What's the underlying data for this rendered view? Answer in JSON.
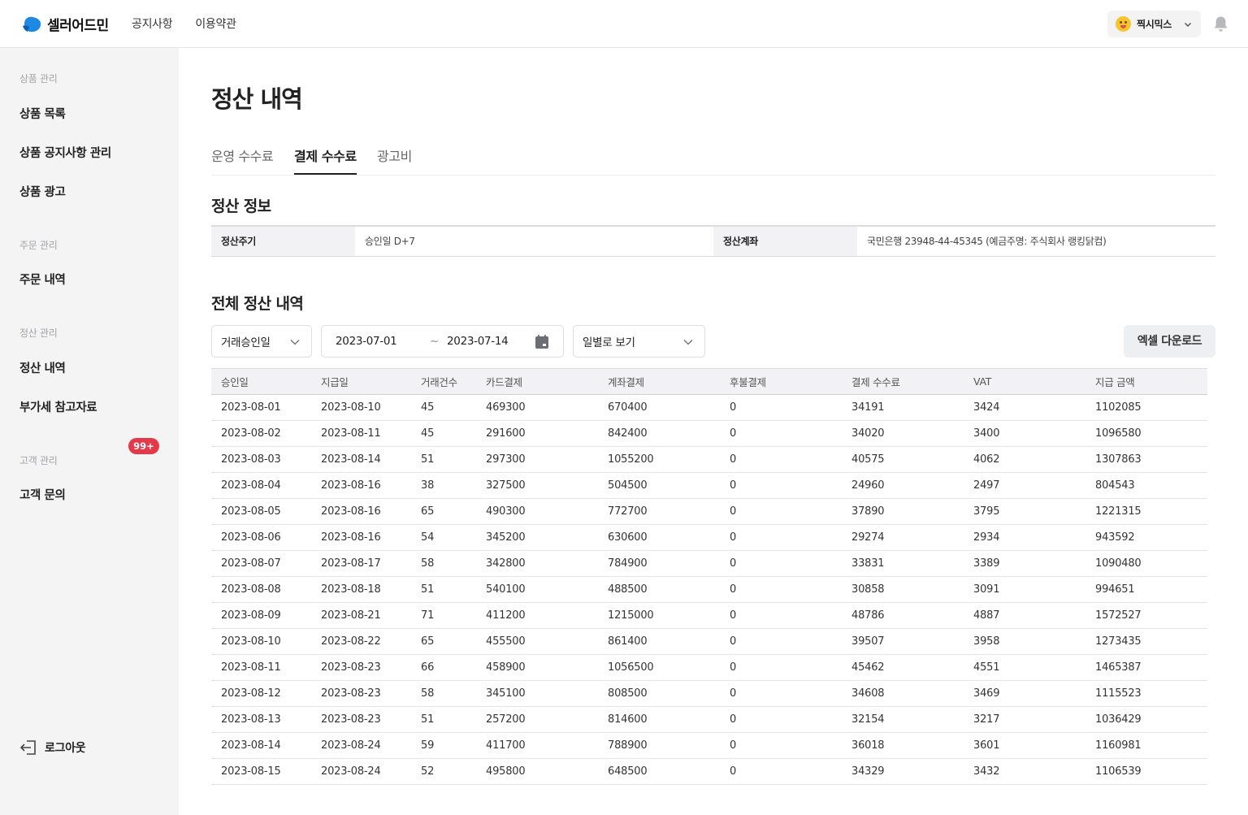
{
  "header": {
    "logo_text": "셀러어드민",
    "nav": [
      "공지사항",
      "이용약관"
    ],
    "user_name": "찍시믹스"
  },
  "sidebar": {
    "groups": [
      {
        "label": "상품 관리",
        "items": [
          "상품 목록",
          "상품 공지사항 관리",
          "상품 광고"
        ]
      },
      {
        "label": "주문 관리",
        "items": [
          "주문 내역"
        ]
      },
      {
        "label": "정산 관리",
        "items": [
          "정산 내역",
          "부가세 참고자료"
        ]
      },
      {
        "label": "고객 관리",
        "items": [
          "고객 문의"
        ]
      }
    ],
    "inquiry_badge": "99+",
    "logout_label": "로그아웃"
  },
  "main": {
    "title": "정산 내역",
    "tabs": [
      "운영 수수료",
      "결제 수수료",
      "광고비"
    ],
    "active_tab": "결제 수수료",
    "info_title": "정산 정보",
    "info": {
      "cycle_label": "정산주기",
      "cycle_value": "승인일 D+7",
      "account_label": "정산계좌",
      "account_value": "국민은행 23948-44-45345 (예금주명: 주식회사 랭킹닭컴)"
    },
    "list_title": "전체 정산 내역",
    "filters": {
      "date_type": "거래승인일",
      "date_from": "2023-07-01",
      "date_sep": "~",
      "date_to": "2023-07-14",
      "view_mode": "일별로 보기"
    },
    "excel_button": "엑셀 다운로드",
    "table": {
      "columns": [
        "승인일",
        "지급일",
        "거래건수",
        "카드결제",
        "계좌결제",
        "후불결제",
        "결제 수수료",
        "VAT",
        "지급 금액"
      ],
      "rows": [
        [
          "2023-08-01",
          "2023-08-10",
          "45",
          "469300",
          "670400",
          "0",
          "34191",
          "3424",
          "1102085"
        ],
        [
          "2023-08-02",
          "2023-08-11",
          "45",
          "291600",
          "842400",
          "0",
          "34020",
          "3400",
          "1096580"
        ],
        [
          "2023-08-03",
          "2023-08-14",
          "51",
          "297300",
          "1055200",
          "0",
          "40575",
          "4062",
          "1307863"
        ],
        [
          "2023-08-04",
          "2023-08-16",
          "38",
          "327500",
          "504500",
          "0",
          "24960",
          "2497",
          "804543"
        ],
        [
          "2023-08-05",
          "2023-08-16",
          "65",
          "490300",
          "772700",
          "0",
          "37890",
          "3795",
          "1221315"
        ],
        [
          "2023-08-06",
          "2023-08-16",
          "54",
          "345200",
          "630600",
          "0",
          "29274",
          "2934",
          "943592"
        ],
        [
          "2023-08-07",
          "2023-08-17",
          "58",
          "342800",
          "784900",
          "0",
          "33831",
          "3389",
          "1090480"
        ],
        [
          "2023-08-08",
          "2023-08-18",
          "51",
          "540100",
          "488500",
          "0",
          "30858",
          "3091",
          "994651"
        ],
        [
          "2023-08-09",
          "2023-08-21",
          "71",
          "411200",
          "1215000",
          "0",
          "48786",
          "4887",
          "1572527"
        ],
        [
          "2023-08-10",
          "2023-08-22",
          "65",
          "455500",
          "861400",
          "0",
          "39507",
          "3958",
          "1273435"
        ],
        [
          "2023-08-11",
          "2023-08-23",
          "66",
          "458900",
          "1056500",
          "0",
          "45462",
          "4551",
          "1465387"
        ],
        [
          "2023-08-12",
          "2023-08-23",
          "58",
          "345100",
          "808500",
          "0",
          "34608",
          "3469",
          "1115523"
        ],
        [
          "2023-08-13",
          "2023-08-23",
          "51",
          "257200",
          "814600",
          "0",
          "32154",
          "3217",
          "1036429"
        ],
        [
          "2023-08-14",
          "2023-08-24",
          "59",
          "411700",
          "788900",
          "0",
          "36018",
          "3601",
          "1160981"
        ],
        [
          "2023-08-15",
          "2023-08-24",
          "52",
          "495800",
          "648500",
          "0",
          "34329",
          "3432",
          "1106539"
        ]
      ]
    }
  },
  "colors": {
    "brand": "#1e88e5",
    "badge": "#e5394a",
    "sidebar_bg": "#f4f4f5"
  }
}
